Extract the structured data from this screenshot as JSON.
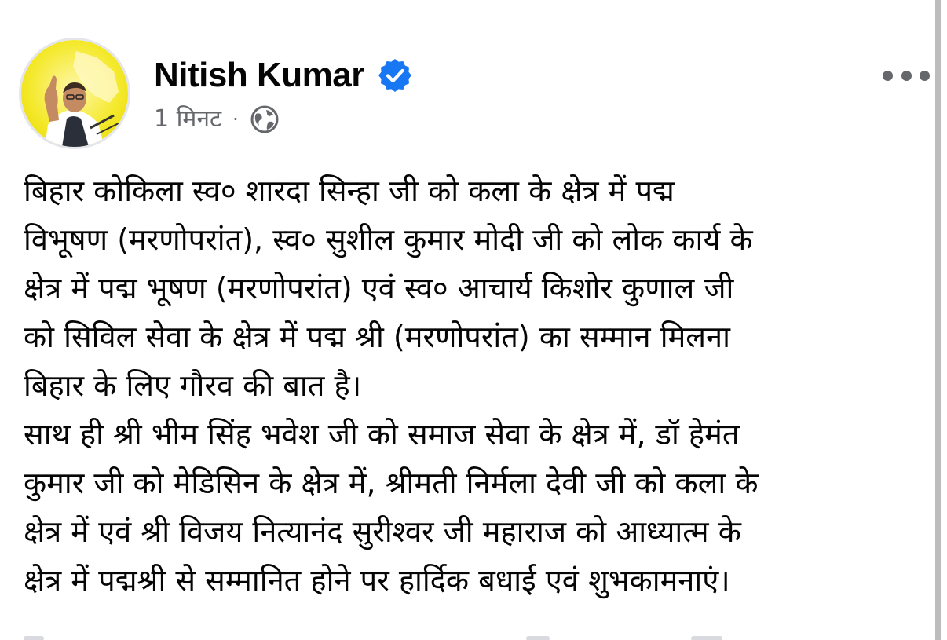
{
  "post": {
    "author": {
      "name": "Nitish Kumar",
      "verified_icon": "verified-badge-icon",
      "avatar_icon": "profile-photo",
      "accent_color": "#1877f2"
    },
    "timestamp": "1 मिनट",
    "separator": "·",
    "privacy_icon": "globe-icon",
    "more_options_icon": "three-dots-icon",
    "content": {
      "paragraph_1": "बिहार कोकिला स्व० शारदा सिन्हा जी को कला के क्षेत्र में पद्म\nविभूषण (मरणोपरांत), स्व० सुशील कुमार मोदी जी को लोक कार्य के\nक्षेत्र में पद्म भूषण (मरणोपरांत) एवं स्व० आचार्य किशोर कुणाल जी\nको सिविल सेवा के क्षेत्र में पद्म श्री (मरणोपरांत) का सम्मान मिलना\nबिहार के लिए गौरव की बात है।",
      "paragraph_2": "साथ ही श्री भीम सिंह भवेश जी को समाज सेवा के क्षेत्र में, डॉ हेमंत\nकुमार जी को मेडिसिन के क्षेत्र में, श्रीमती निर्मला देवी जी को कला के\nक्षेत्र में एवं श्री विजय नित्यानंद सुरीश्वर जी महाराज को आध्यात्म के\nक्षेत्र में पद्मश्री से सम्मानित होने पर हार्दिक बधाई एवं शुभकामनाएं।"
    }
  }
}
